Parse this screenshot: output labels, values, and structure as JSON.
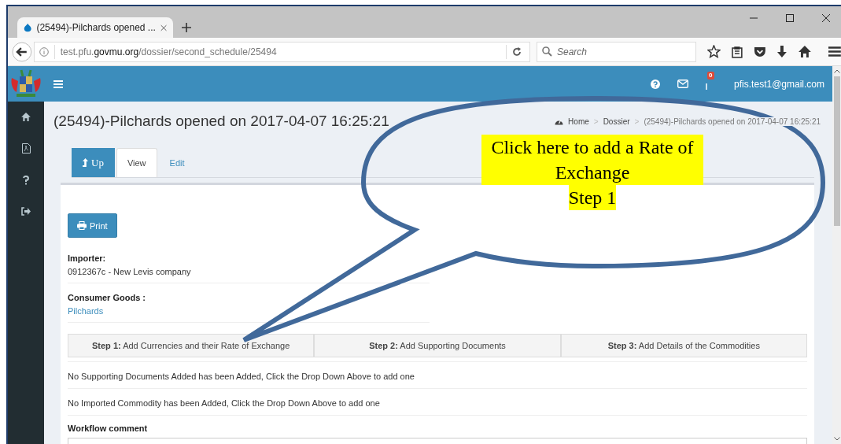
{
  "browser": {
    "tab_title": "(25494)-Pilchards opened ...",
    "url": {
      "prefix": "test.pfu.",
      "domain": "govmu.org",
      "path": "/dossier/second_schedule/25494"
    },
    "search_placeholder": "Search"
  },
  "header": {
    "notification_count": "0",
    "user_email": "pfis.test1@gmail.com"
  },
  "page_title": "(25494)-Pilchards opened on 2017-04-07 16:25:21",
  "breadcrumb_separator": ">",
  "breadcrumb": [
    {
      "label": "Home",
      "kind": "home"
    },
    {
      "label": "Dossier",
      "kind": "link"
    },
    {
      "label": "(25494)-Pilchards opened on 2017-04-07 16:25:21",
      "kind": "current"
    }
  ],
  "tabs": [
    {
      "label": "Up",
      "kind": "button",
      "selected": false
    },
    {
      "label": "View",
      "kind": "tab",
      "selected": true
    },
    {
      "label": "Edit",
      "kind": "tab",
      "selected": false
    }
  ],
  "print_button": "Print",
  "fields": [
    {
      "label": "Importer:",
      "value": "0912367c - New Levis company",
      "kind": "text"
    },
    {
      "label": "Consumer Goods :",
      "value": "Pilchards",
      "kind": "link"
    }
  ],
  "steps": [
    {
      "step": "Step 1:",
      "label": "Add Currencies and their Rate of Exchange"
    },
    {
      "step": "Step 2:",
      "label": "Add Supporting Documents"
    },
    {
      "step": "Step 3:",
      "label": "Add Details of the Commodities"
    }
  ],
  "messages": [
    "No Supporting Documents Added has been Added, Click the Drop Down Above to add one",
    "No Imported Commodity has been Added, Click the Drop Down Above to add one"
  ],
  "workflow_comment_label": "Workflow comment",
  "callout": {
    "text": "Click here to add a Rate of Exchange",
    "step": "Step 1"
  }
}
